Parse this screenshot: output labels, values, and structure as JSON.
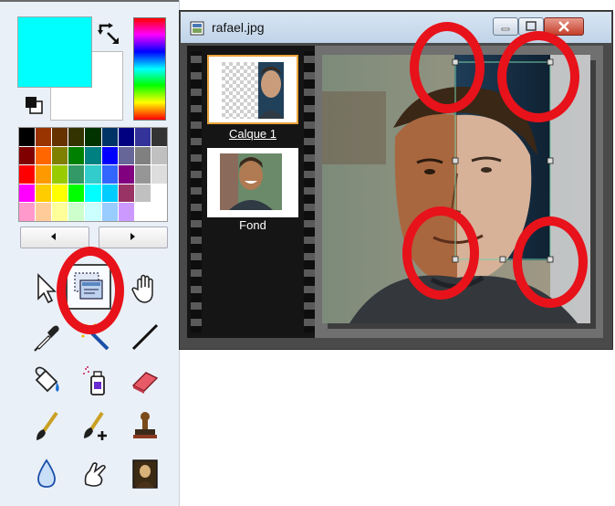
{
  "window": {
    "title": "rafael.jpg"
  },
  "layers": [
    {
      "name": "Calque 1"
    },
    {
      "name": "Fond"
    }
  ],
  "colors": {
    "foreground": "#00ffff",
    "background": "#ffffff",
    "annotation": "#e8121a",
    "palette": [
      "#000000",
      "#993300",
      "#663300",
      "#333300",
      "#003300",
      "#003366",
      "#000080",
      "#333399",
      "#333333",
      "#800000",
      "#ff6600",
      "#808000",
      "#008000",
      "#008080",
      "#0000ff",
      "#666699",
      "#808080",
      "#c0c0c0",
      "#ff0000",
      "#ff9900",
      "#99cc00",
      "#339966",
      "#33cccc",
      "#3366ff",
      "#800080",
      "#969696",
      "#dddddd",
      "#ff00ff",
      "#ffcc00",
      "#ffff00",
      "#00ff00",
      "#00ffff",
      "#00ccff",
      "#993366",
      "#c0c0c0",
      "#ffffff",
      "#ff99cc",
      "#ffcc99",
      "#ffff99",
      "#ccffcc",
      "#ccffff",
      "#99ccff",
      "#cc99ff",
      "#ffffff",
      "#ffffff"
    ]
  },
  "tools": [
    "pointer-arrow-icon",
    "layer-select-icon",
    "hand-pan-icon",
    "eyedropper-icon",
    "magic-wand-icon",
    "line-icon",
    "paint-bucket-icon",
    "spray-can-icon",
    "eraser-icon",
    "brush-icon",
    "brush-plus-icon",
    "stamp-icon",
    "water-drop-icon",
    "smudge-finger-icon",
    "portrait-picture-icon"
  ],
  "selected_tool": "layer-select-icon"
}
